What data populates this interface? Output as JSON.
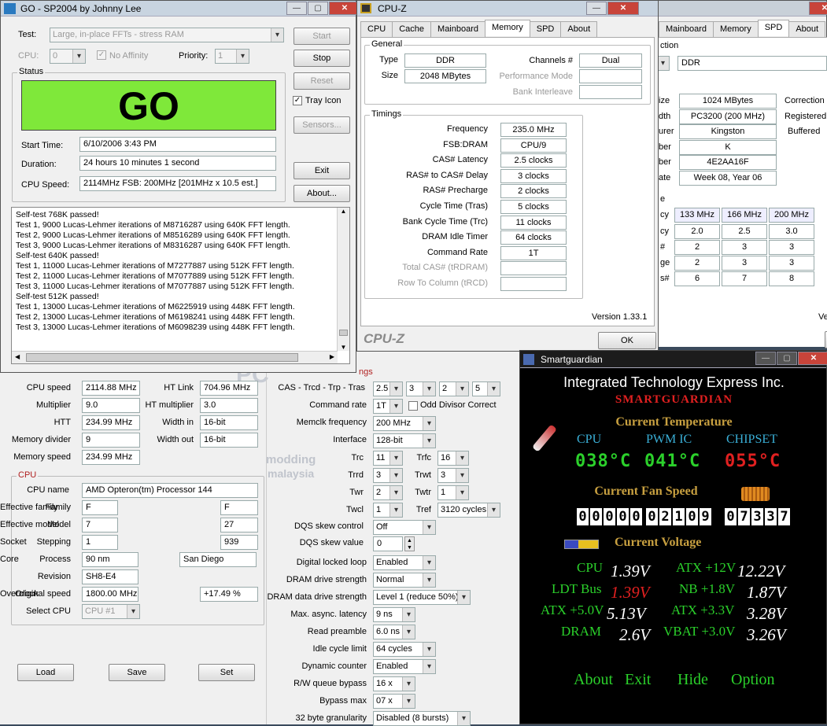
{
  "spd_bg": {
    "tabs": [
      "Mainboard",
      "Memory",
      "SPD",
      "About"
    ],
    "active": "SPD",
    "section_label": "ction",
    "slot": "",
    "mem_type": "DDR",
    "module_rows": [
      {
        "label": "ize",
        "value": "1024 MBytes"
      },
      {
        "label": "dth",
        "value": "PC3200 (200 MHz)"
      },
      {
        "label": "urer",
        "value": "Kingston"
      },
      {
        "label": "ber",
        "value": "K"
      },
      {
        "label": "ber",
        "value": "4E2AA16F"
      },
      {
        "label": "ate",
        "value": "Week 08, Year 06"
      }
    ],
    "right_labels": [
      "Correction",
      "Registered",
      "Buffered"
    ],
    "table_label": "e",
    "freq_row": {
      "label": "cy",
      "values": [
        "133 MHz",
        "166 MHz",
        "200 MHz"
      ]
    },
    "rows": [
      {
        "label": "cy",
        "values": [
          "2.0",
          "2.5",
          "3.0"
        ]
      },
      {
        "label": "#",
        "values": [
          "2",
          "3",
          "3"
        ]
      },
      {
        "label": "ge",
        "values": [
          "2",
          "3",
          "3"
        ]
      },
      {
        "label": "s#",
        "values": [
          "6",
          "7",
          "8"
        ]
      }
    ],
    "version_frag": "Ve"
  },
  "a64": {
    "watermark_top": "modding",
    "watermark_mid": "PC",
    "watermark_bot": "malaysia",
    "timings_frag": "ngs",
    "left_fields": [
      {
        "label": "CPU speed",
        "value": "2114.88 MHz"
      },
      {
        "label": "Multiplier",
        "value": "9.0"
      },
      {
        "label": "HTT",
        "value": "234.99 MHz"
      },
      {
        "label": "Memory divider",
        "value": "9"
      },
      {
        "label": "Memory speed",
        "value": "234.99 MHz"
      }
    ],
    "ht_fields": [
      {
        "label": "HT Link",
        "value": "704.96 MHz"
      },
      {
        "label": "HT multiplier",
        "value": "3.0"
      },
      {
        "label": "Width in",
        "value": "16-bit"
      },
      {
        "label": "Width out",
        "value": "16-bit"
      }
    ],
    "cpu_group": "CPU",
    "cpu_name_label": "CPU name",
    "cpu_name": "AMD Opteron(tm) Processor 144",
    "cpu_left": [
      {
        "label": "Family",
        "value": "F"
      },
      {
        "label": "Model",
        "value": "7"
      },
      {
        "label": "Stepping",
        "value": "1"
      },
      {
        "label": "Process",
        "value": "90 nm"
      },
      {
        "label": "Revision",
        "value": "SH8-E4"
      },
      {
        "label": "Original speed",
        "value": "1800.00 MHz"
      }
    ],
    "cpu_right": [
      {
        "label": "Effective family",
        "value": "F"
      },
      {
        "label": "Effective model",
        "value": "27"
      },
      {
        "label": "Socket",
        "value": "939"
      },
      {
        "label": "Core",
        "value": "San Diego"
      },
      {
        "label": "Overclock",
        "value": "+17.49 %"
      }
    ],
    "select_cpu_label": "Select CPU",
    "select_cpu": "CPU #1",
    "load": "Load",
    "save": "Save",
    "set": "Set",
    "cas_label": "CAS - Trcd - Trp - Tras",
    "cas": [
      "2.5",
      "3",
      "2",
      "5"
    ],
    "cmd_rate_label": "Command rate",
    "cmd_rate": "1T",
    "odd_div": "Odd Divisor Correct",
    "memclk_label": "Memclk frequency",
    "memclk": "200 MHz",
    "iface_label": "Interface",
    "iface": "128-bit",
    "t_left": [
      {
        "label": "Trc",
        "value": "11"
      },
      {
        "label": "Trrd",
        "value": "3"
      },
      {
        "label": "Twr",
        "value": "2"
      },
      {
        "label": "Twcl",
        "value": "1"
      }
    ],
    "t_right": [
      {
        "label": "Trfc",
        "value": "16"
      },
      {
        "label": "Trwt",
        "value": "3"
      },
      {
        "label": "Twtr",
        "value": "1"
      },
      {
        "label": "Tref",
        "value": "3120 cycles"
      }
    ],
    "dqs_ctrl_label": "DQS skew control",
    "dqs_ctrl": "Off",
    "dqs_val_label": "DQS skew value",
    "dqs_val": "0",
    "opts": [
      {
        "label": "Digital locked loop",
        "value": "Enabled"
      },
      {
        "label": "DRAM drive strength",
        "value": "Normal"
      },
      {
        "label": "DRAM data drive strength",
        "value": "Level 1 (reduce 50%)"
      },
      {
        "label": "Max. async. latency",
        "value": "9 ns"
      },
      {
        "label": "Read preamble",
        "value": "6.0 ns"
      },
      {
        "label": "Idle cycle limit",
        "value": "64 cycles"
      },
      {
        "label": "Dynamic counter",
        "value": "Enabled"
      },
      {
        "label": "R/W queue bypass",
        "value": "16 x"
      },
      {
        "label": "Bypass max",
        "value": "07 x"
      },
      {
        "label": "32 byte granularity",
        "value": "Disabled (8 bursts)"
      }
    ]
  },
  "sp": {
    "title": "GO - SP2004 by Johnny Lee",
    "test_label": "Test:",
    "test": "Large, in-place FFTs - stress RAM",
    "cpu_label": "CPU:",
    "cpu": "0",
    "no_affinity": "No Affinity",
    "priority_label": "Priority:",
    "priority": "1",
    "start": "Start",
    "stop": "Stop",
    "reset": "Reset",
    "tray_icon": "Tray Icon",
    "sensors": "Sensors...",
    "exit": "Exit",
    "about": "About...",
    "status_label": "Status",
    "go": "GO",
    "start_time_label": "Start Time:",
    "start_time": "6/10/2006 3:43 PM",
    "duration_label": "Duration:",
    "duration": "24 hours 10 minutes 1 second",
    "cpu_speed_label": "CPU Speed:",
    "cpu_speed": "2114MHz FSB: 200MHz [201MHz x 10.5 est.]",
    "log": [
      "Self-test 768K passed!",
      "Test 1, 9000 Lucas-Lehmer iterations of M8716287 using 640K FFT length.",
      "Test 2, 9000 Lucas-Lehmer iterations of M8516289 using 640K FFT length.",
      "Test 3, 9000 Lucas-Lehmer iterations of M8316287 using 640K FFT length.",
      "Self-test 640K passed!",
      "Test 1, 11000 Lucas-Lehmer iterations of M7277887 using 512K FFT length.",
      "Test 2, 11000 Lucas-Lehmer iterations of M7077889 using 512K FFT length.",
      "Test 3, 11000 Lucas-Lehmer iterations of M7077887 using 512K FFT length.",
      "Self-test 512K passed!",
      "Test 1, 13000 Lucas-Lehmer iterations of M6225919 using 448K FFT length.",
      "Test 2, 13000 Lucas-Lehmer iterations of M6198241 using 448K FFT length.",
      "Test 3, 13000 Lucas-Lehmer iterations of M6098239 using 448K FFT length."
    ]
  },
  "cpuz": {
    "title": "CPU-Z",
    "tabs": [
      "CPU",
      "Cache",
      "Mainboard",
      "Memory",
      "SPD",
      "About"
    ],
    "active": "Memory",
    "general": "General",
    "type_label": "Type",
    "type": "DDR",
    "size_label": "Size",
    "size": "2048 MBytes",
    "channels_label": "Channels #",
    "channels": "Dual",
    "perf_label": "Performance Mode",
    "bank_label": "Bank Interleave",
    "timings": "Timings",
    "rows": [
      {
        "label": "Frequency",
        "value": "235.0 MHz",
        "dis": false
      },
      {
        "label": "FSB:DRAM",
        "value": "CPU/9",
        "dis": false
      },
      {
        "label": "CAS# Latency",
        "value": "2.5 clocks",
        "dis": false
      },
      {
        "label": "RAS# to CAS# Delay",
        "value": "3 clocks",
        "dis": false
      },
      {
        "label": "RAS# Precharge",
        "value": "2 clocks",
        "dis": false
      },
      {
        "label": "Cycle Time (Tras)",
        "value": "5 clocks",
        "dis": false
      },
      {
        "label": "Bank Cycle Time (Trc)",
        "value": "11 clocks",
        "dis": false
      },
      {
        "label": "DRAM Idle Timer",
        "value": "64 clocks",
        "dis": false
      },
      {
        "label": "Command Rate",
        "value": "1T",
        "dis": false
      },
      {
        "label": "Total CAS# (tRDRAM)",
        "value": "",
        "dis": true
      },
      {
        "label": "Row To Column (tRCD)",
        "value": "",
        "dis": true
      }
    ],
    "version": "Version 1.33.1",
    "brand": "CPU-Z",
    "ok": "OK"
  },
  "sgd": {
    "title": "Smartguardian",
    "company": "Integrated Technology Express Inc.",
    "product": "SMARTGUARDIAN",
    "cur_temp": "Current Temperature",
    "temps": [
      {
        "label": "CPU",
        "value": "038°C",
        "color": "#2bd02b"
      },
      {
        "label": "PWM IC",
        "value": "041°C",
        "color": "#2bd02b"
      },
      {
        "label": "CHIPSET",
        "value": "055°C",
        "color": "#e02020"
      }
    ],
    "cur_fan": "Current Fan Speed",
    "fans": [
      "00000",
      "02109",
      "07337"
    ],
    "cur_volt": "Current Voltage",
    "volts_left": [
      {
        "label": "CPU",
        "value": "1.39V",
        "alarm": false
      },
      {
        "label": "LDT Bus",
        "value": "1.39V",
        "alarm": true
      },
      {
        "label": "ATX +5.0V",
        "value": "5.13V",
        "alarm": false
      },
      {
        "label": "DRAM",
        "value": "2.6V",
        "alarm": false
      }
    ],
    "volts_right": [
      {
        "label": "ATX +12V",
        "value": "12.22V"
      },
      {
        "label": "NB +1.8V",
        "value": "1.87V"
      },
      {
        "label": "ATX +3.3V",
        "value": "3.28V"
      },
      {
        "label": "VBAT +3.0V",
        "value": "3.26V"
      }
    ],
    "menu": [
      "About",
      "Exit",
      "Hide",
      "Option"
    ]
  },
  "colors": {
    "go_green": "#7fe83a",
    "sg_gold": "#c8a040",
    "sg_red": "#e02020",
    "sg_green": "#2bd02b"
  }
}
